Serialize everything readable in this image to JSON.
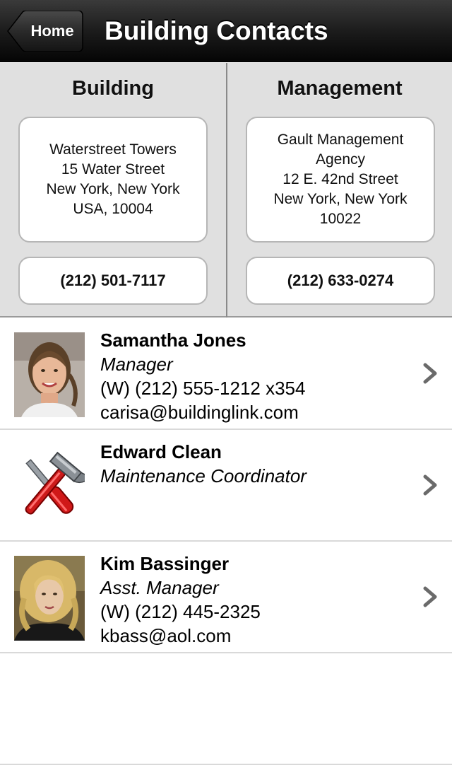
{
  "navbar": {
    "back_label": "Home",
    "title": "Building Contacts"
  },
  "building": {
    "heading": "Building",
    "address": [
      "Waterstreet Towers",
      "15 Water Street",
      "New York, New York",
      "USA, 10004"
    ],
    "phone": "(212) 501-7117"
  },
  "management": {
    "heading": "Management",
    "address": [
      "Gault Management",
      "Agency",
      "12 E. 42nd Street",
      "New York, New York",
      "10022"
    ],
    "phone": "(212) 633-0274"
  },
  "contacts": [
    {
      "name": "Samantha Jones",
      "role": "Manager",
      "phone": "(W) (212) 555-1212 x354",
      "email": "carisa@buildinglink.com",
      "avatar": "person-photo"
    },
    {
      "name": "Edward Clean",
      "role": "Maintenance Coordinator",
      "phone": "",
      "email": "",
      "avatar": "tools-icon"
    },
    {
      "name": "Kim Bassinger",
      "role": "Asst. Manager",
      "phone": "(W) (212) 445-2325",
      "email": "kbass@aol.com",
      "avatar": "person-photo"
    }
  ]
}
